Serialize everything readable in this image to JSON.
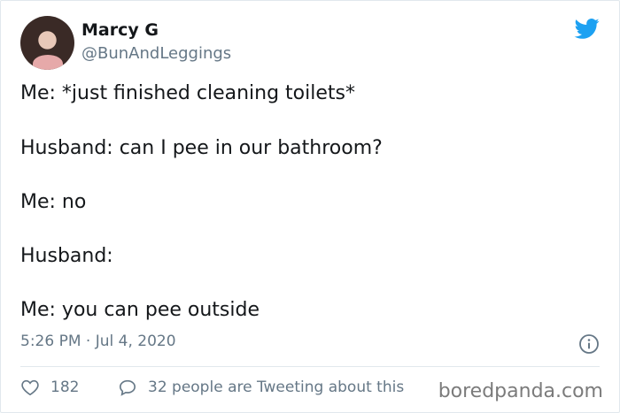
{
  "tweet": {
    "author_name": "Marcy G",
    "author_handle": "@BunAndLeggings",
    "lines": [
      "Me: *just finished cleaning toilets*",
      "Husband: can I pee in our bathroom?",
      "Me: no",
      "Husband:",
      "Me: you can pee outside"
    ],
    "timestamp": "5:26 PM · Jul 4, 2020",
    "likes_count": "182",
    "comments_text": "32 people are Tweeting about this",
    "brand_color": "#1da1f2",
    "icons": {
      "logo": "twitter-bird-icon",
      "info": "info-icon",
      "like": "heart-icon",
      "comment": "comment-icon"
    }
  },
  "watermark": "boredpanda.com"
}
